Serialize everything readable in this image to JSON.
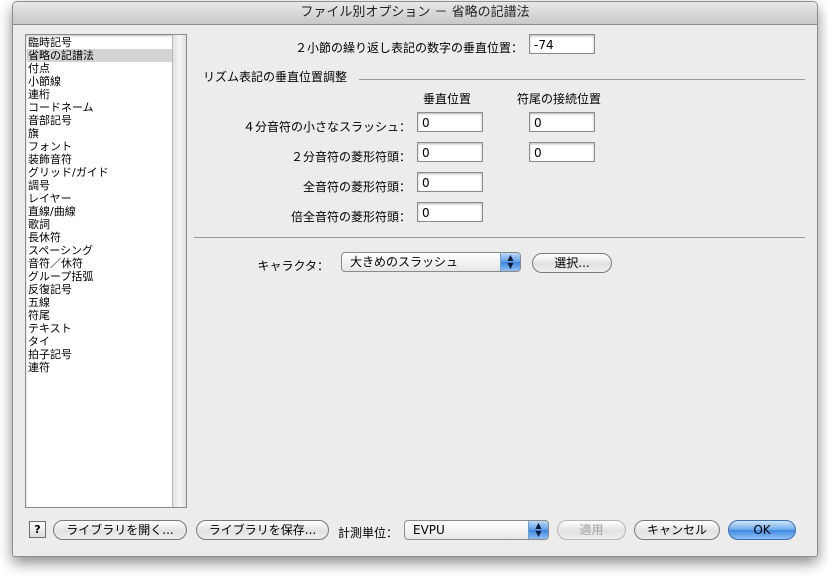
{
  "window": {
    "title": "ファイル別オプション － 省略の記譜法"
  },
  "sidebar": {
    "items": [
      {
        "label": "臨時記号",
        "selected": false
      },
      {
        "label": "省略の記譜法",
        "selected": true
      },
      {
        "label": "付点",
        "selected": false
      },
      {
        "label": "小節線",
        "selected": false
      },
      {
        "label": "連桁",
        "selected": false
      },
      {
        "label": "コードネーム",
        "selected": false
      },
      {
        "label": "音部記号",
        "selected": false
      },
      {
        "label": "旗",
        "selected": false
      },
      {
        "label": "フォント",
        "selected": false
      },
      {
        "label": "装飾音符",
        "selected": false
      },
      {
        "label": "グリッド/ガイド",
        "selected": false
      },
      {
        "label": "調号",
        "selected": false
      },
      {
        "label": "レイヤー",
        "selected": false
      },
      {
        "label": "直線/曲線",
        "selected": false
      },
      {
        "label": "歌詞",
        "selected": false
      },
      {
        "label": "長休符",
        "selected": false
      },
      {
        "label": "スペーシング",
        "selected": false
      },
      {
        "label": "音符／休符",
        "selected": false
      },
      {
        "label": "グループ括弧",
        "selected": false
      },
      {
        "label": "反復記号",
        "selected": false
      },
      {
        "label": "五線",
        "selected": false
      },
      {
        "label": "符尾",
        "selected": false
      },
      {
        "label": "テキスト",
        "selected": false
      },
      {
        "label": "タイ",
        "selected": false
      },
      {
        "label": "拍子記号",
        "selected": false
      },
      {
        "label": "連符",
        "selected": false
      }
    ]
  },
  "main": {
    "repeat_number_label": "２小節の繰り返し表記の数字の垂直位置：",
    "repeat_number_value": "-74",
    "rhythm_section_title": "リズム表記の垂直位置調整",
    "col_vertical": "垂直位置",
    "col_stem": "符尾の接続位置",
    "rows": [
      {
        "label": "４分音符の小さなスラッシュ：",
        "vertical": "0",
        "stem": "0"
      },
      {
        "label": "２分音符の菱形符頭：",
        "vertical": "0",
        "stem": "0"
      },
      {
        "label": "全音符の菱形符頭：",
        "vertical": "0"
      },
      {
        "label": "倍全音符の菱形符頭：",
        "vertical": "0"
      }
    ],
    "character_label": "キャラクタ：",
    "character_value": "大きめのスラッシュ",
    "select_button": "選択..."
  },
  "footer": {
    "help": "?",
    "open_library": "ライブラリを開く...",
    "save_library": "ライブラリを保存...",
    "units_label": "計測単位：",
    "units_value": "EVPU",
    "apply": "適用",
    "cancel": "キャンセル",
    "ok": "OK"
  },
  "colors": {
    "accent": "#3e8ae4",
    "selection": "#d4d4d4"
  },
  "icons": {
    "popup_arrows": "up-down-arrows-icon",
    "help": "question-mark-icon"
  }
}
